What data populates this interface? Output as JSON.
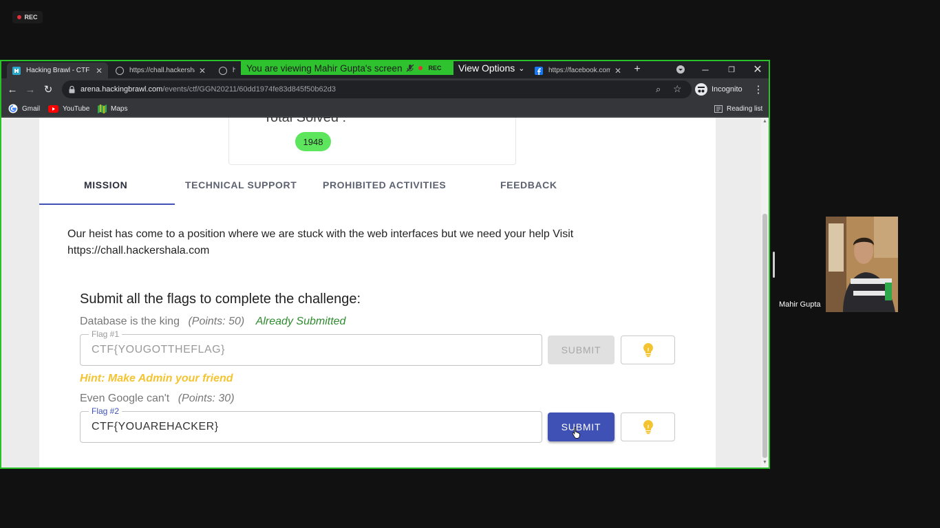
{
  "recording": {
    "label": "REC"
  },
  "browser": {
    "tabs": [
      {
        "title": "Hacking Brawl - CTF C",
        "active": true,
        "icon": "hackingbrawl-favicon"
      },
      {
        "title": "https://chall.hackersha",
        "active": false,
        "icon": "globe-icon"
      },
      {
        "title": "htt",
        "active": false,
        "icon": "globe-icon"
      },
      {
        "title": "https://facebook.com",
        "active": false,
        "icon": "facebook-icon"
      }
    ],
    "new_tab": "+",
    "address": {
      "host": "arena.hackingbrawl.com",
      "path": "/events/ctf/GGN20211/60dd1974fe83d845f50b62d3"
    },
    "profile": "Incognito",
    "bookmarks": [
      {
        "label": "Gmail",
        "icon": "google-icon"
      },
      {
        "label": "YouTube",
        "icon": "youtube-icon"
      },
      {
        "label": "Maps",
        "icon": "maps-icon"
      }
    ],
    "reading_list": "Reading list"
  },
  "share_banner": {
    "text": "You are viewing Mahir Gupta's screen",
    "rec": "REC",
    "view_options": "View Options"
  },
  "page": {
    "solved_label": "Total Solved :",
    "solved_count": "1948",
    "tabs": [
      "MISSION",
      "TECHNICAL SUPPORT",
      "PROHIBITED ACTIVITIES",
      "FEEDBACK"
    ],
    "active_tab": "MISSION",
    "mission_line1": "Our heist has come to a position where we are stuck with the web interfaces but we need your help Visit",
    "mission_line2": "https://chall.hackershala.com",
    "flags_heading": "Submit all the flags to complete the challenge:",
    "challenges": [
      {
        "name": "Database is the king",
        "points": "(Points: 50)",
        "status": "Already Submitted",
        "flag_label": "Flag #1",
        "flag_value": "CTF{YOUGOTTHEFLAG}",
        "submit": "SUBMIT",
        "hint": "Hint: Make Admin your friend"
      },
      {
        "name": "Even Google can't",
        "points": "(Points: 30)",
        "status": "",
        "flag_label": "Flag #2",
        "flag_value": "CTF{YOUAREHACKER}",
        "submit": "SUBMIT"
      }
    ]
  },
  "participant": {
    "name": "Mahir Gupta"
  },
  "colors": {
    "share_border": "#29c229",
    "primary": "#3f51b5",
    "solved_pill": "#5de65d",
    "hint": "#f4c430"
  }
}
